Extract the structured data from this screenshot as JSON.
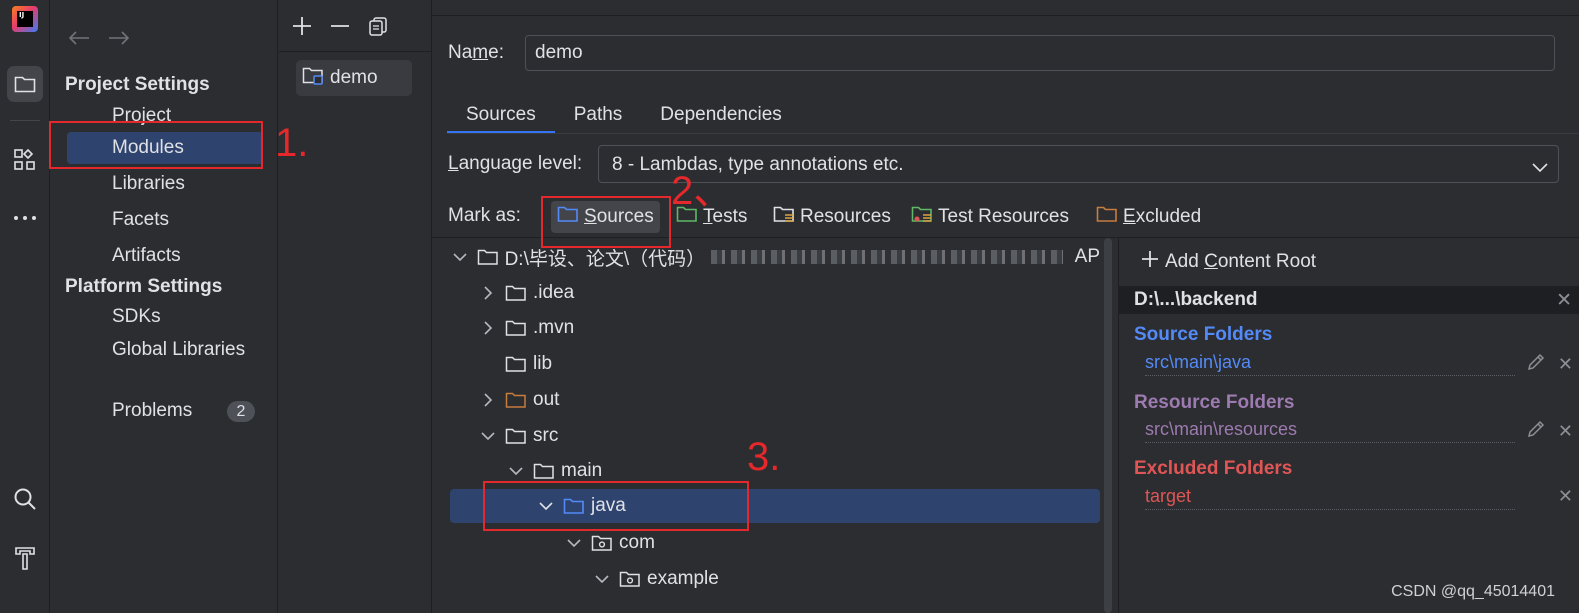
{
  "colors": {
    "accent": "#3574f0",
    "selection": "#2e436e",
    "annotation": "#e4282b",
    "source_folders": "#548af7",
    "resource_folders": "#9d7ab0",
    "excluded_folders": "#e05555",
    "test_green": "#5fb865",
    "excluded_orange": "#c77d3e"
  },
  "app": {
    "logo_text": "IJ",
    "logo_icon": "intellij-logo-icon"
  },
  "activity_bar": {
    "icons": [
      "project-folder-icon",
      "structure-icon",
      "more-icon",
      "search-icon",
      "build-hammer-icon"
    ]
  },
  "nav": {
    "back_icon": "arrow-left-icon",
    "forward_icon": "arrow-right-icon",
    "project_settings": "Project Settings",
    "project_items": [
      "Project",
      "Modules",
      "Libraries",
      "Facets",
      "Artifacts"
    ],
    "platform_settings": "Platform Settings",
    "platform_items": [
      "SDKs",
      "Global Libraries"
    ],
    "problems_label": "Problems",
    "problems_count": "2"
  },
  "modules": {
    "toolbar": [
      "add-icon",
      "remove-icon",
      "copy-icon"
    ],
    "items": [
      "demo"
    ]
  },
  "main": {
    "name_label_pre": "Na",
    "name_label_mn": "m",
    "name_label_post": "e:",
    "name_value": "demo",
    "tabs": [
      "Sources",
      "Paths",
      "Dependencies"
    ],
    "language_level_label_u": "L",
    "language_level_label_rest": "anguage level:",
    "language_level_value": "8 - Lambdas, type annotations etc.",
    "mark_as_label": "Mark as:",
    "mark_buttons": [
      {
        "u": "S",
        "rest": "ources",
        "icon": "sources-folder-icon"
      },
      {
        "u": "T",
        "rest": "ests",
        "icon": "tests-folder-icon"
      },
      {
        "u": "",
        "rest": "Resources",
        "icon": "resources-folder-icon"
      },
      {
        "u": "",
        "rest": "Test Resources",
        "icon": "test-resources-folder-icon"
      },
      {
        "u": "E",
        "rest": "xcluded",
        "icon": "excluded-folder-icon"
      }
    ]
  },
  "tree": {
    "root_prefix": "D:\\毕设、论文\\（代码）",
    "root_suffix": "AP",
    "rows": [
      ".idea",
      ".mvn",
      "lib",
      "out",
      "src",
      "main",
      "java",
      "com",
      "example"
    ]
  },
  "content_root": {
    "add_label_pre": "Add ",
    "add_label_u": "C",
    "add_label_post": "ontent Root",
    "root_path": "D:\\...\\backend",
    "source_head": "Source Folders",
    "source_path": "src\\main\\java",
    "resource_head": "Resource Folders",
    "resource_path": "src\\main\\resources",
    "excluded_head": "Excluded Folders",
    "excluded_path": "target"
  },
  "annotations": [
    "1.",
    "2、",
    "3."
  ],
  "watermark": "CSDN @qq_45014401"
}
